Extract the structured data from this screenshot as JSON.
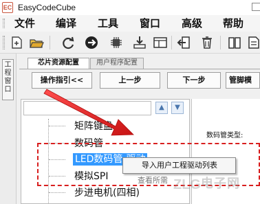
{
  "window": {
    "title": "EasyCodeCube",
    "logo_text": "EC"
  },
  "menu": [
    "文件",
    "编译",
    "工具",
    "窗口",
    "高级",
    "帮助"
  ],
  "side_panel": {
    "label": "工程窗口"
  },
  "tabs": [
    {
      "label": "芯片资源配置",
      "active": true
    },
    {
      "label": "用户程序配置",
      "active": false
    }
  ],
  "steps": {
    "guide": "操作指引<<",
    "prev": "上一步",
    "next": "下一步",
    "pins": "管脚模"
  },
  "tree": {
    "items": [
      "矩阵键盘",
      "数码管",
      "LED数码管-驱动",
      "模拟SPI",
      "步进电机(四相)"
    ]
  },
  "properties": {
    "label": "数码管类型:"
  },
  "context_menu": {
    "items": [
      "导入用户工程驱动列表"
    ],
    "ghost_text": "查看所需"
  },
  "watermark": {
    "logo": "ZLG",
    "text": "电子网"
  },
  "colors": {
    "selection": "#3399ff",
    "annotation_red": "#d81e1e"
  }
}
